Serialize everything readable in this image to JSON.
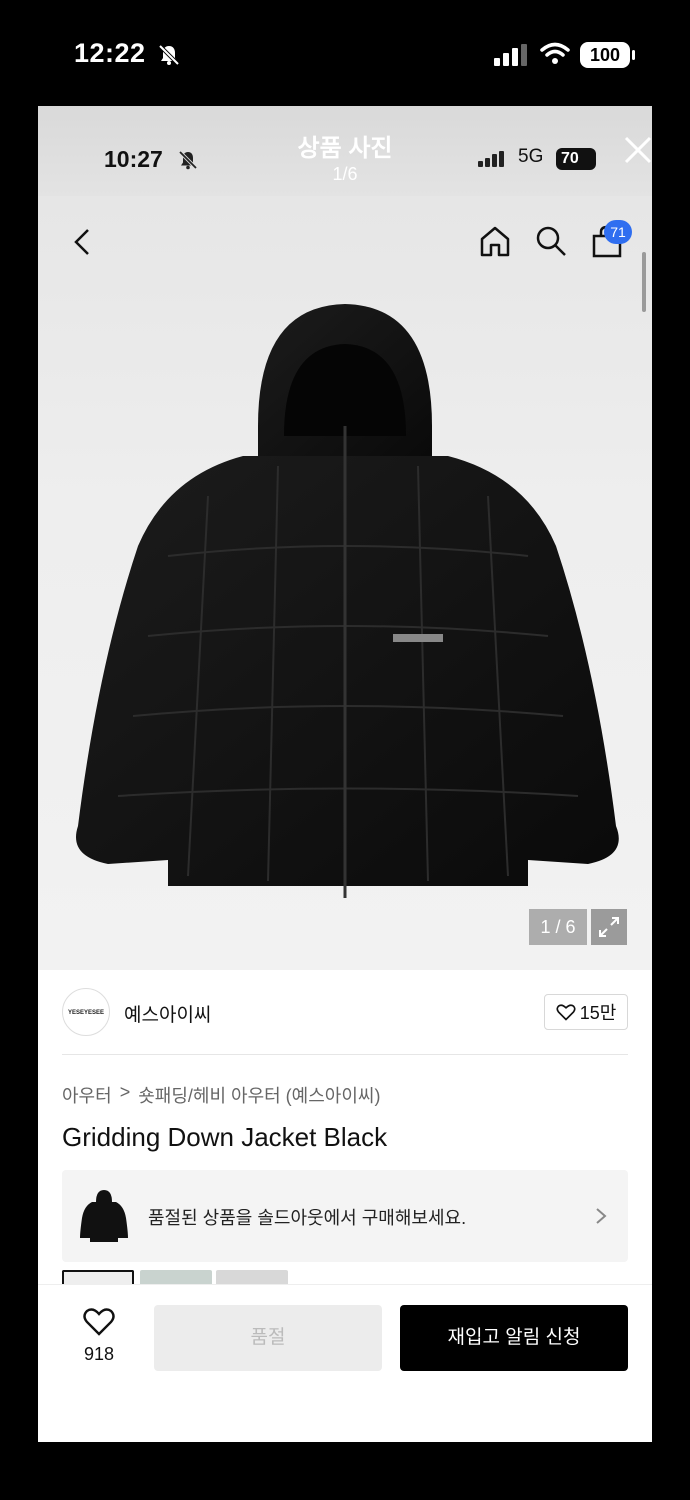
{
  "outer_status": {
    "time": "12:22",
    "battery": "100"
  },
  "viewer": {
    "title": "상품 사진",
    "count": "1/6"
  },
  "inner_status": {
    "time": "10:27",
    "network": "5G",
    "battery": "70"
  },
  "nav": {
    "cart_badge": "71"
  },
  "image": {
    "counter": "1 / 6"
  },
  "brand": {
    "logo_text": "YESEYESEE",
    "name": "예스아이씨",
    "likes": "15만"
  },
  "breadcrumb": [
    "아우터",
    ">",
    "숏패딩/헤비 아우터 (예스아이씨)"
  ],
  "product": {
    "title": "Gridding Down Jacket Black"
  },
  "soldout_banner": {
    "text": "품절된 상품을 솔드아웃에서 구매해보세요."
  },
  "bottom_bar": {
    "wish_count": "918",
    "soldout_label": "품절",
    "restock_label": "재입고 알림 신청"
  },
  "colors": {
    "accent_badge": "#2f6ef0",
    "primary_button": "#000000"
  }
}
